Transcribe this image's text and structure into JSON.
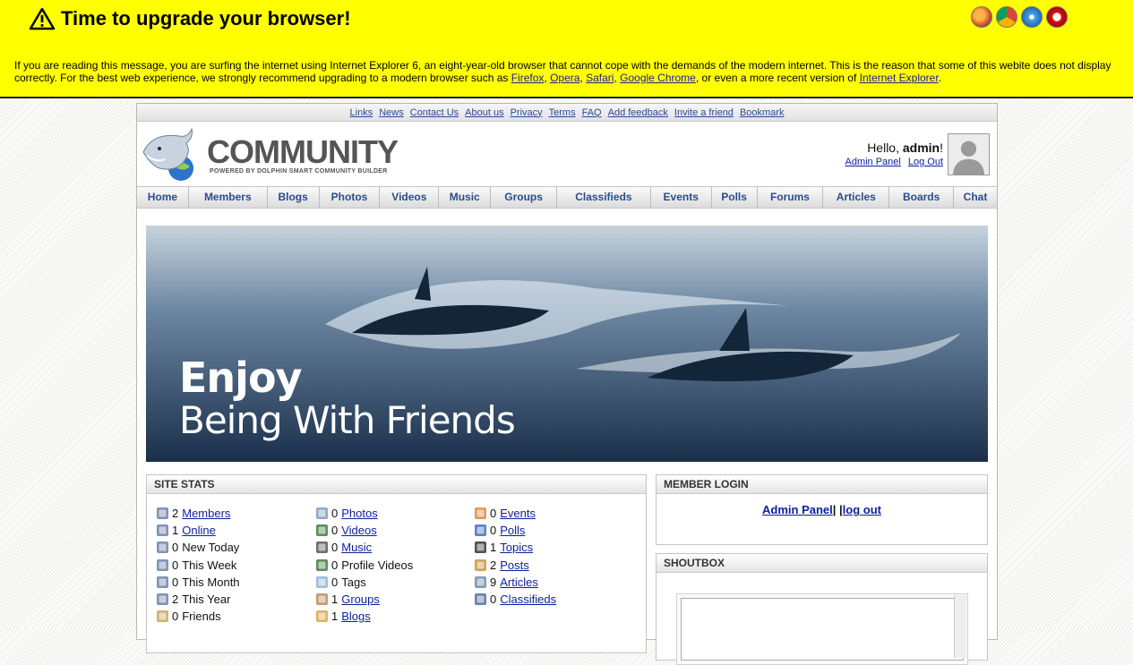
{
  "upgrade": {
    "title": "Time to upgrade your browser!",
    "message_start": "If you are reading this message, you are surfing the internet using Internet Explorer 6, an eight-year-old browser that cannot cope with the demands of the modern internet. This is the reason that some of this webite does not display correctly. For the best web experience, we strongly recommend upgrading to a modern browser such as ",
    "links": [
      "Firefox",
      "Opera",
      "Safari",
      "Google Chrome"
    ],
    "or_text": ", or even a more recent version of ",
    "ie_link": "Internet Explorer",
    "end": ".",
    "browser_icons": [
      "firefox-icon",
      "chrome-icon",
      "safari-icon",
      "opera-icon"
    ],
    "colors": {
      "background": "#ffff00"
    }
  },
  "top_links": [
    "Links",
    "News",
    "Contact Us",
    "About us",
    "Privacy",
    "Terms",
    "FAQ",
    "Add feedback",
    "Invite a friend",
    "Bookmark"
  ],
  "header": {
    "logo_text": "COMMUNITY",
    "logo_sub": "POWERED BY DOLPHIN SMART COMMUNITY BUILDER",
    "hello_prefix": "Hello, ",
    "username": "admin",
    "hello_suffix": "!",
    "admin_panel": "Admin Panel",
    "logout": "Log Out"
  },
  "nav": [
    "Home",
    "Members",
    "Blogs",
    "Photos",
    "Videos",
    "Music",
    "Groups",
    "Classifieds",
    "Events",
    "Polls",
    "Forums",
    "Articles",
    "Boards",
    "Chat"
  ],
  "hero": {
    "line1": "Enjoy",
    "line2": "Being With Friends"
  },
  "site_stats": {
    "title": "SITE STATS",
    "col1": [
      {
        "num": "2",
        "label": "Members",
        "link": true,
        "icon": "members-icon"
      },
      {
        "num": "1",
        "label": "Online",
        "link": true,
        "icon": "online-icon"
      },
      {
        "num": "0",
        "label": "New Today",
        "link": false,
        "icon": "member-today-icon"
      },
      {
        "num": "0",
        "label": "This Week",
        "link": false,
        "icon": "member-week-icon"
      },
      {
        "num": "0",
        "label": "This Month",
        "link": false,
        "icon": "member-month-icon"
      },
      {
        "num": "2",
        "label": "This Year",
        "link": false,
        "icon": "member-year-icon"
      },
      {
        "num": "0",
        "label": "Friends",
        "link": false,
        "icon": "friends-icon"
      }
    ],
    "col2": [
      {
        "num": "0",
        "label": "Photos",
        "link": true,
        "icon": "photos-icon"
      },
      {
        "num": "0",
        "label": "Videos",
        "link": true,
        "icon": "videos-icon"
      },
      {
        "num": "0",
        "label": "Music",
        "link": true,
        "icon": "music-icon"
      },
      {
        "num": "0",
        "label": "Profile Videos",
        "link": false,
        "icon": "profile-videos-icon"
      },
      {
        "num": "0",
        "label": "Tags",
        "link": false,
        "icon": "tags-icon"
      },
      {
        "num": "1",
        "label": "Groups",
        "link": true,
        "icon": "groups-icon"
      },
      {
        "num": "1",
        "label": "Blogs",
        "link": true,
        "icon": "blogs-icon"
      }
    ],
    "col3": [
      {
        "num": "0",
        "label": "Events",
        "link": true,
        "icon": "events-icon"
      },
      {
        "num": "0",
        "label": "Polls",
        "link": true,
        "icon": "polls-icon"
      },
      {
        "num": "1",
        "label": "Topics",
        "link": true,
        "icon": "topics-icon"
      },
      {
        "num": "2",
        "label": "Posts",
        "link": true,
        "icon": "posts-icon"
      },
      {
        "num": "9",
        "label": "Articles",
        "link": true,
        "icon": "articles-icon"
      },
      {
        "num": "0",
        "label": "Classifieds",
        "link": true,
        "icon": "classifieds-icon"
      }
    ]
  },
  "member_login": {
    "title": "MEMBER LOGIN",
    "admin_panel": "Admin Panel",
    "sep": "| |",
    "logout": "log out"
  },
  "shoutbox": {
    "title": "SHOUTBOX"
  }
}
